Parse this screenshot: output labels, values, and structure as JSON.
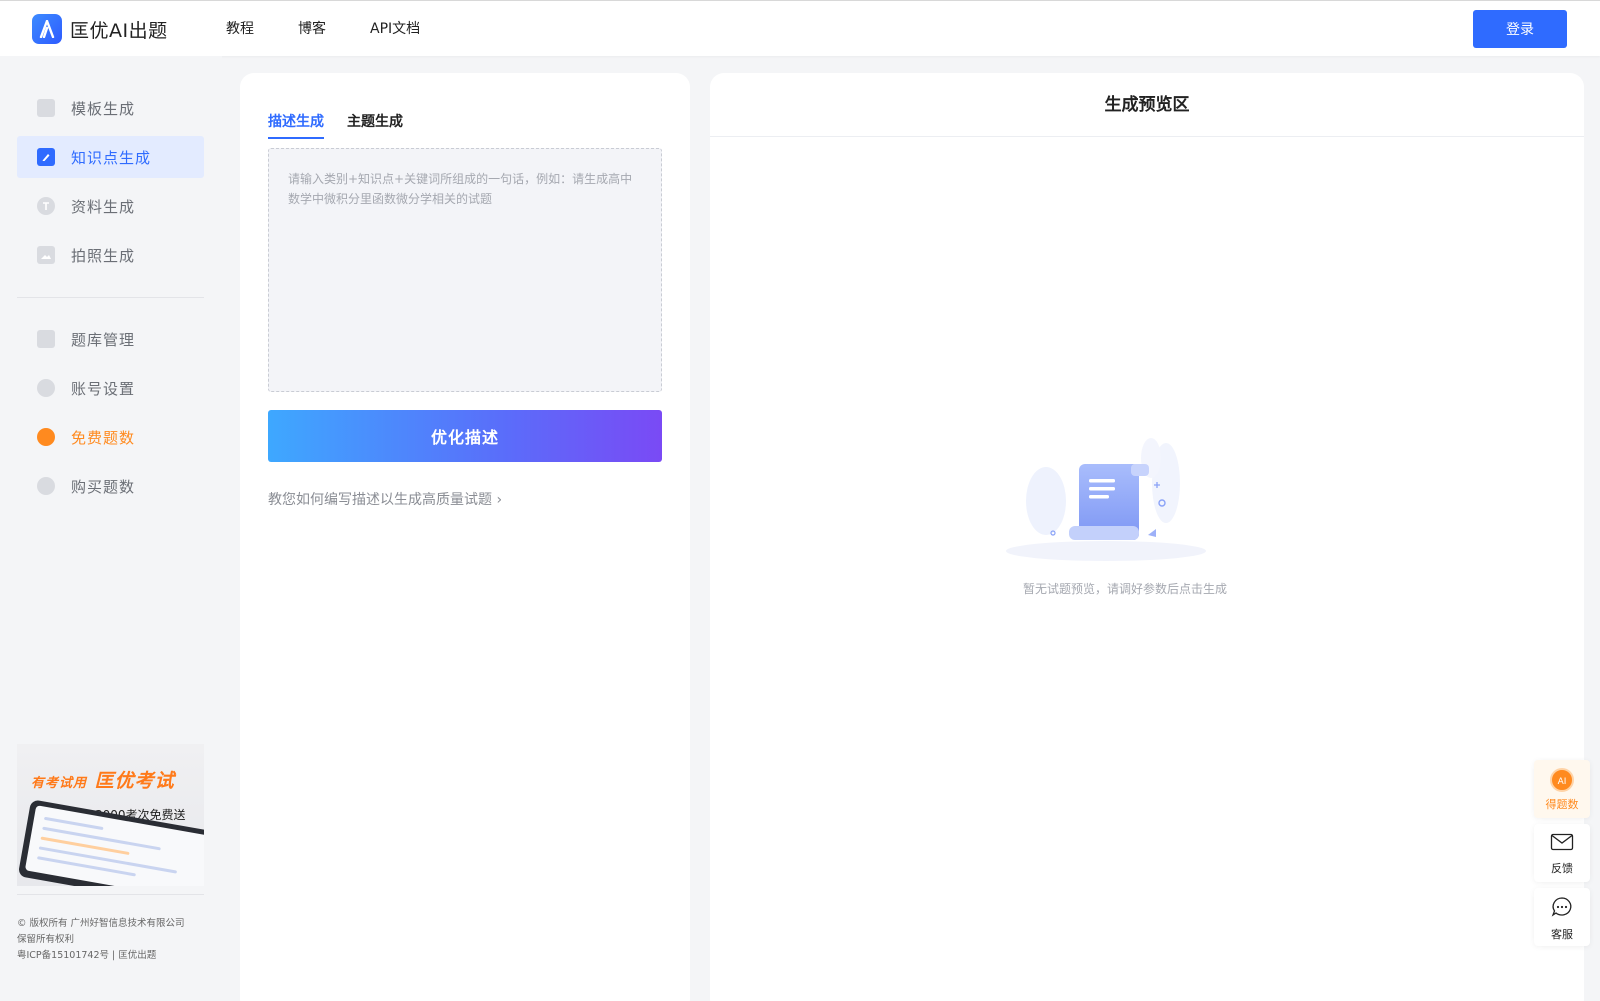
{
  "header": {
    "logo_text": "匡优AI出题",
    "nav": [
      "教程",
      "博客",
      "API文档"
    ],
    "login_label": "登录"
  },
  "sidebar": {
    "menu_top": [
      {
        "label": "模板生成",
        "icon": "template-icon",
        "active": false
      },
      {
        "label": "知识点生成",
        "icon": "edit-icon",
        "active": true
      },
      {
        "label": "资料生成",
        "icon": "text-icon",
        "active": false
      },
      {
        "label": "拍照生成",
        "icon": "image-icon",
        "active": false
      }
    ],
    "menu_bottom": [
      {
        "label": "题库管理",
        "icon": "library-icon"
      },
      {
        "label": "账号设置",
        "icon": "user-icon"
      },
      {
        "label": "免费题数",
        "icon": "ai-coin-icon",
        "highlight": "#ff8a1f"
      },
      {
        "label": "购买题数",
        "icon": "diamond-icon"
      }
    ],
    "promo": {
      "title_small": "有考试用",
      "title_big": "匡优考试",
      "subtitle": "3000考次免费送"
    },
    "footer": [
      "© 版权所有 广州好智信息技术有限公司",
      "保留所有权利",
      "粤ICP备15101742号 | 匡优出题"
    ]
  },
  "generator": {
    "tabs": [
      "描述生成",
      "主题生成"
    ],
    "active_tab": 0,
    "input_placeholder": "请输入类别+知识点+关键词所组成的一句话，例如：请生成高中数学中微积分里函数微分学相关的试题",
    "optimize_label": "优化描述",
    "help_link": "教您如何编写描述以生成高质量试题",
    "help_arrow": "›"
  },
  "preview": {
    "title": "生成预览区",
    "empty_text": "暂无试题预览，请调好参数后点击生成"
  },
  "float_buttons": [
    {
      "label": "得题数",
      "icon": "ai-coin-icon",
      "badge": "AI"
    },
    {
      "label": "反馈",
      "icon": "mail-icon"
    },
    {
      "label": "客服",
      "icon": "chat-icon"
    }
  ],
  "colors": {
    "primary": "#2f6bff",
    "accent_orange": "#ff8a1f",
    "background": "#f4f5f7"
  }
}
